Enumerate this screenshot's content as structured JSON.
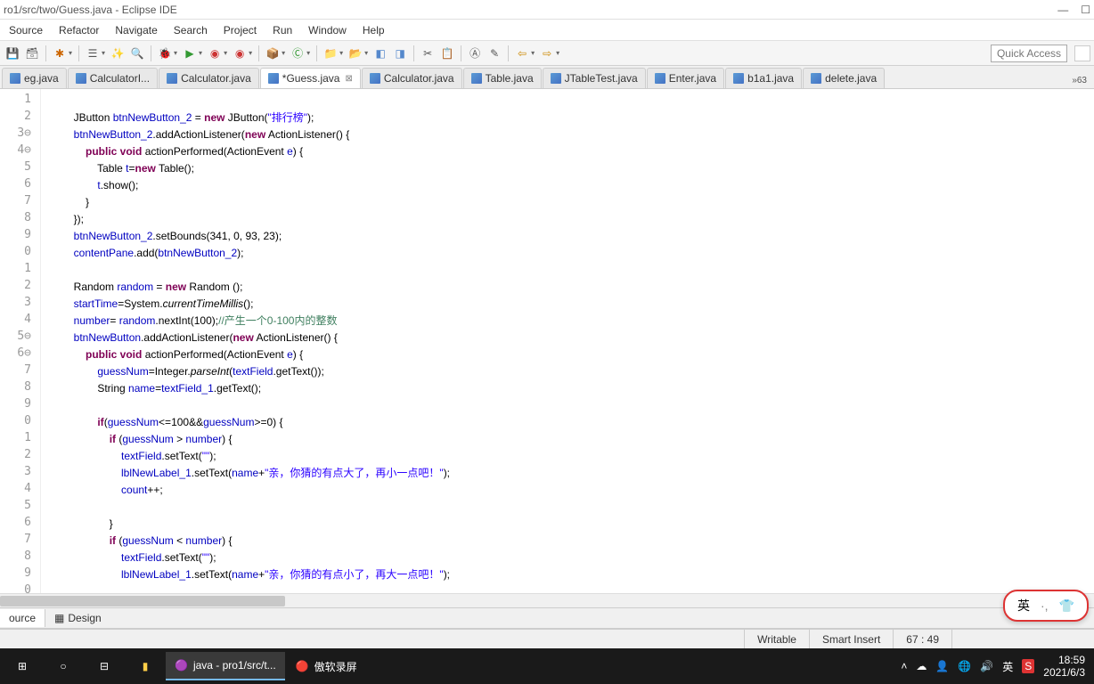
{
  "title_path": "ro1/src/two/Guess.java - Eclipse IDE",
  "menu": [
    "Source",
    "Refactor",
    "Navigate",
    "Search",
    "Project",
    "Run",
    "Window",
    "Help"
  ],
  "quick_access": "Quick Access",
  "tabs": [
    {
      "label": "eg.java"
    },
    {
      "label": "CalculatorI..."
    },
    {
      "label": "Calculator.java"
    },
    {
      "label": "*Guess.java",
      "active": true,
      "close": true
    },
    {
      "label": "Calculator.java"
    },
    {
      "label": "Table.java"
    },
    {
      "label": "JTableTest.java"
    },
    {
      "label": "Enter.java"
    },
    {
      "label": "b1a1.java"
    },
    {
      "label": "delete.java"
    }
  ],
  "tab_more": "»63",
  "gutter": [
    "1",
    "2",
    "3⊖",
    "4⊖",
    "5",
    "6",
    "7",
    "8",
    "9",
    "0",
    "1",
    "2",
    "3",
    "4",
    "5⊖",
    "6⊖",
    "7",
    "8",
    "9",
    "0",
    "1",
    "2",
    "3",
    "4",
    "5",
    "6",
    "7",
    "8",
    "9",
    "0"
  ],
  "code_lines": [
    {
      "t": ""
    },
    {
      "i": 2,
      "segs": [
        {
          "c": "",
          "t": "JButton "
        },
        {
          "c": "fld",
          "t": "btnNewButton_2"
        },
        {
          "c": "",
          "t": " = "
        },
        {
          "c": "kw",
          "t": "new"
        },
        {
          "c": "",
          "t": " JButton("
        },
        {
          "c": "str",
          "t": "\"排行榜\""
        },
        {
          "c": "",
          "t": ");"
        }
      ]
    },
    {
      "i": 2,
      "segs": [
        {
          "c": "fld",
          "t": "btnNewButton_2"
        },
        {
          "c": "",
          "t": ".addActionListener("
        },
        {
          "c": "kw",
          "t": "new"
        },
        {
          "c": "",
          "t": " ActionListener() {"
        }
      ]
    },
    {
      "i": 3,
      "segs": [
        {
          "c": "kw",
          "t": "public void"
        },
        {
          "c": "",
          "t": " actionPerformed(ActionEvent "
        },
        {
          "c": "fld",
          "t": "e"
        },
        {
          "c": "",
          "t": ") {"
        }
      ]
    },
    {
      "i": 4,
      "segs": [
        {
          "c": "",
          "t": "Table "
        },
        {
          "c": "fld",
          "t": "t"
        },
        {
          "c": "",
          "t": "="
        },
        {
          "c": "kw",
          "t": "new"
        },
        {
          "c": "",
          "t": " Table();"
        }
      ]
    },
    {
      "i": 4,
      "segs": [
        {
          "c": "fld",
          "t": "t"
        },
        {
          "c": "",
          "t": ".show();"
        }
      ]
    },
    {
      "i": 3,
      "segs": [
        {
          "c": "",
          "t": "}"
        }
      ]
    },
    {
      "i": 2,
      "segs": [
        {
          "c": "",
          "t": "});"
        }
      ]
    },
    {
      "i": 2,
      "segs": [
        {
          "c": "fld",
          "t": "btnNewButton_2"
        },
        {
          "c": "",
          "t": ".setBounds(341, 0, 93, 23);"
        }
      ]
    },
    {
      "i": 2,
      "segs": [
        {
          "c": "fld",
          "t": "contentPane"
        },
        {
          "c": "",
          "t": ".add("
        },
        {
          "c": "fld",
          "t": "btnNewButton_2"
        },
        {
          "c": "",
          "t": ");"
        }
      ]
    },
    {
      "t": ""
    },
    {
      "i": 2,
      "segs": [
        {
          "c": "",
          "t": "Random "
        },
        {
          "c": "fld",
          "t": "random"
        },
        {
          "c": "",
          "t": " = "
        },
        {
          "c": "kw",
          "t": "new"
        },
        {
          "c": "",
          "t": " Random ();"
        }
      ]
    },
    {
      "i": 2,
      "segs": [
        {
          "c": "fld",
          "t": "startTime"
        },
        {
          "c": "",
          "t": "=System."
        },
        {
          "c": "mth",
          "t": "currentTimeMillis"
        },
        {
          "c": "",
          "t": "();"
        }
      ]
    },
    {
      "i": 2,
      "segs": [
        {
          "c": "fld",
          "t": "number"
        },
        {
          "c": "",
          "t": "= "
        },
        {
          "c": "fld",
          "t": "random"
        },
        {
          "c": "",
          "t": ".nextInt(100);"
        },
        {
          "c": "cm",
          "t": "//产生一个0-100内的整数"
        }
      ]
    },
    {
      "i": 2,
      "segs": [
        {
          "c": "fld",
          "t": "btnNewButton"
        },
        {
          "c": "",
          "t": ".addActionListener("
        },
        {
          "c": "kw",
          "t": "new"
        },
        {
          "c": "",
          "t": " ActionListener() {"
        }
      ]
    },
    {
      "i": 3,
      "segs": [
        {
          "c": "kw",
          "t": "public void"
        },
        {
          "c": "",
          "t": " actionPerformed(ActionEvent "
        },
        {
          "c": "fld",
          "t": "e"
        },
        {
          "c": "",
          "t": ") {"
        }
      ]
    },
    {
      "i": 4,
      "segs": [
        {
          "c": "fld",
          "t": "guessNum"
        },
        {
          "c": "",
          "t": "=Integer."
        },
        {
          "c": "mth",
          "t": "parseInt"
        },
        {
          "c": "",
          "t": "("
        },
        {
          "c": "fld",
          "t": "textField"
        },
        {
          "c": "",
          "t": ".getText());"
        }
      ]
    },
    {
      "i": 4,
      "segs": [
        {
          "c": "",
          "t": "String "
        },
        {
          "c": "fld",
          "t": "name"
        },
        {
          "c": "",
          "t": "="
        },
        {
          "c": "fld",
          "t": "textField_1"
        },
        {
          "c": "",
          "t": ".getText();"
        }
      ]
    },
    {
      "t": ""
    },
    {
      "i": 4,
      "segs": [
        {
          "c": "kw",
          "t": "if"
        },
        {
          "c": "",
          "t": "("
        },
        {
          "c": "fld",
          "t": "guessNum"
        },
        {
          "c": "",
          "t": "<=100&&"
        },
        {
          "c": "fld",
          "t": "guessNum"
        },
        {
          "c": "",
          "t": ">=0) {"
        }
      ]
    },
    {
      "i": 5,
      "segs": [
        {
          "c": "kw",
          "t": "if"
        },
        {
          "c": "",
          "t": " ("
        },
        {
          "c": "fld",
          "t": "guessNum"
        },
        {
          "c": "",
          "t": " > "
        },
        {
          "c": "fld",
          "t": "number"
        },
        {
          "c": "",
          "t": ") {"
        }
      ]
    },
    {
      "i": 6,
      "segs": [
        {
          "c": "fld",
          "t": "textField"
        },
        {
          "c": "",
          "t": ".setText("
        },
        {
          "c": "str",
          "t": "\"\""
        },
        {
          "c": "",
          "t": ");"
        }
      ]
    },
    {
      "i": 6,
      "segs": [
        {
          "c": "fld",
          "t": "lblNewLabel_1"
        },
        {
          "c": "",
          "t": ".setText("
        },
        {
          "c": "fld",
          "t": "name"
        },
        {
          "c": "",
          "t": "+"
        },
        {
          "c": "str",
          "t": "\"亲，你猜的有点大了，再小一点吧！\""
        },
        {
          "c": "",
          "t": ");"
        }
      ]
    },
    {
      "i": 6,
      "segs": [
        {
          "c": "fld",
          "t": "count"
        },
        {
          "c": "",
          "t": "++;"
        }
      ]
    },
    {
      "t": ""
    },
    {
      "i": 5,
      "segs": [
        {
          "c": "",
          "t": "}"
        }
      ]
    },
    {
      "i": 5,
      "segs": [
        {
          "c": "kw",
          "t": "if"
        },
        {
          "c": "",
          "t": " ("
        },
        {
          "c": "fld",
          "t": "guessNum"
        },
        {
          "c": "",
          "t": " < "
        },
        {
          "c": "fld",
          "t": "number"
        },
        {
          "c": "",
          "t": ") {"
        }
      ]
    },
    {
      "i": 6,
      "segs": [
        {
          "c": "fld",
          "t": "textField"
        },
        {
          "c": "",
          "t": ".setText("
        },
        {
          "c": "str",
          "t": "\"\""
        },
        {
          "c": "",
          "t": ");"
        }
      ]
    },
    {
      "i": 6,
      "segs": [
        {
          "c": "fld",
          "t": "lblNewLabel_1"
        },
        {
          "c": "",
          "t": ".setText("
        },
        {
          "c": "fld",
          "t": "name"
        },
        {
          "c": "",
          "t": "+"
        },
        {
          "c": "str",
          "t": "\"亲，你猜的有点小了，再大一点吧！\""
        },
        {
          "c": "",
          "t": ");"
        }
      ]
    }
  ],
  "bottom_tabs": [
    {
      "label": "ource"
    },
    {
      "label": "Design",
      "icon": true
    }
  ],
  "status": {
    "writable": "Writable",
    "insert": "Smart Insert",
    "pos": "67 : 49"
  },
  "taskbar": {
    "items": [
      {
        "label": "java - pro1/src/t...",
        "active": true,
        "icon": "eclipse"
      },
      {
        "label": "傲软录屏",
        "active": false,
        "icon": "rec"
      }
    ],
    "time": "18:59",
    "date": "2021/6/3"
  },
  "ime": {
    "lang": "英",
    "dots": "·,"
  }
}
